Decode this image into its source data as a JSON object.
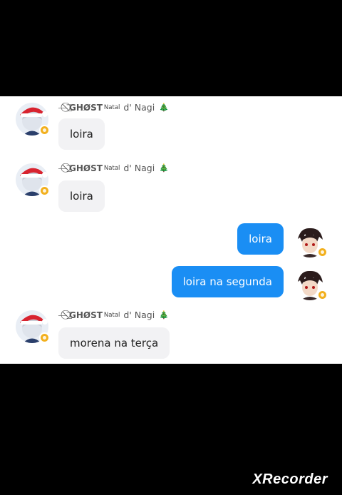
{
  "messages": [
    {
      "sender": "ghost",
      "name_prefix": "—͟͞͞",
      "name_main": "GHØST",
      "name_sup": "Natal",
      "name_suffix": "d' Nagi",
      "tree": "🎄",
      "text": "loira"
    },
    {
      "sender": "ghost",
      "name_prefix": "—͟͞͞",
      "name_main": "GHØST",
      "name_sup": "Natal",
      "name_suffix": "d' Nagi",
      "tree": "🎄",
      "text": "loira"
    },
    {
      "sender": "me",
      "text": "loira"
    },
    {
      "sender": "me",
      "text": "loira na segunda"
    },
    {
      "sender": "ghost",
      "name_prefix": "—͟͞͞",
      "name_main": "GHØST",
      "name_sup": "Natal",
      "name_suffix": "d' Nagi",
      "tree": "🎄",
      "text": "morena na terça"
    }
  ],
  "watermark": "XRecorder",
  "colors": {
    "outgoing_bubble": "#1a8ef4",
    "incoming_bubble": "#f2f2f4",
    "badge": "#f2b01e"
  }
}
